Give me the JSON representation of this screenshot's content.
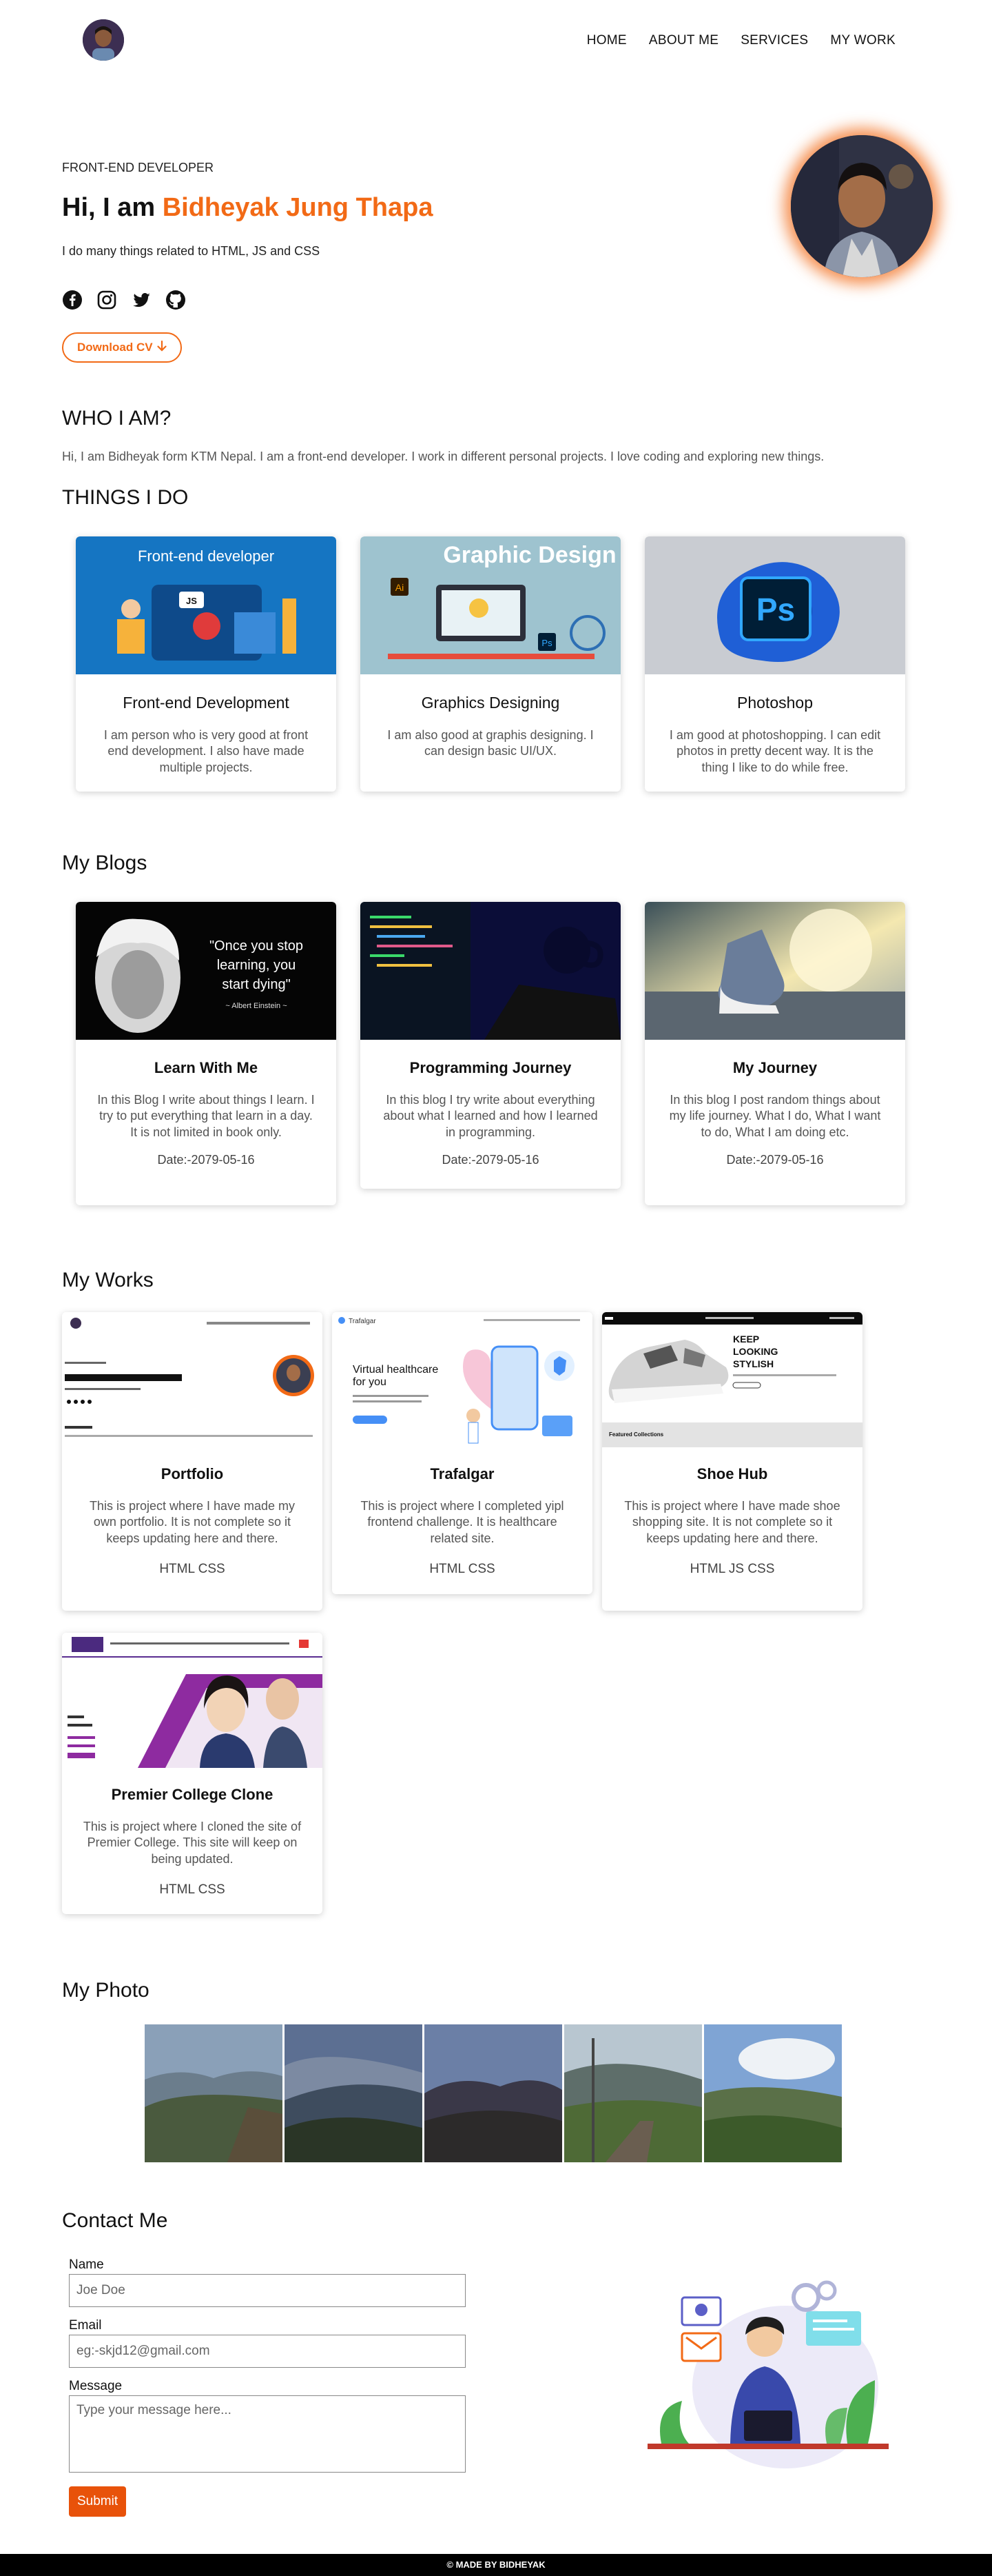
{
  "nav": {
    "links": [
      "HOME",
      "ABOUT ME",
      "SERVICES",
      "MY WORK"
    ]
  },
  "hero": {
    "role": "FRONT-END DEVELOPER",
    "greeting": "Hi, I am ",
    "name": "Bidheyak Jung Thapa",
    "subtitle": "I do many things related to HTML, JS and CSS",
    "social_icons": [
      "facebook-icon",
      "instagram-icon",
      "twitter-icon",
      "github-icon"
    ],
    "cv_button": "Download CV",
    "accent": "#f26a16"
  },
  "who": {
    "heading": "WHO I AM?",
    "text": "Hi, I am Bidheyak form KTM Nepal. I am a front-end developer. I work in different personal projects. I love coding and exploring new things."
  },
  "things": {
    "heading": "THINGS I DO",
    "cards": [
      {
        "title": "Front-end Development",
        "text": "I am person who is very good at front end development. I also have made multiple projects.",
        "image_caption": "Front-end developer"
      },
      {
        "title": "Graphics Designing",
        "text": "I am also good at graphis designing. I can design basic UI/UX.",
        "image_caption": "Graphic Design"
      },
      {
        "title": "Photoshop",
        "text": "I am good at photoshopping. I can edit photos in pretty decent way. It is the thing I like to do while free.",
        "image_caption": "Ps"
      }
    ]
  },
  "blogs": {
    "heading": "My Blogs",
    "cards": [
      {
        "title": "Learn With Me",
        "text": "In this Blog I write about things I learn. I try to put everything that learn in a day. It is not limited in book only.",
        "date": "Date:-2079-05-16",
        "quote": "\"Once you stop learning, you start dying\"",
        "quote_author": "~ Albert Einstein ~"
      },
      {
        "title": "Programming Journey",
        "text": "In this blog I try write about everything about what I learned and how I learned in programming.",
        "date": "Date:-2079-05-16"
      },
      {
        "title": "My Journey",
        "text": "In this blog I post random things about my life journey. What I do, What I want to do, What I am doing etc.",
        "date": "Date:-2079-05-16"
      }
    ]
  },
  "works": {
    "heading": "My Works",
    "cards": [
      {
        "title": "Portfolio",
        "text": "This is project where I have made my own portfolio. It is not complete so it keeps updating here and there.",
        "tech": "HTML CSS"
      },
      {
        "title": "Trafalgar",
        "text": "This is project where I completed yipl frontend challenge. It is healthcare related site.",
        "tech": "HTML CSS",
        "preview_heading": "Virtual healthcare for you",
        "preview_logo": "Trafalgar"
      },
      {
        "title": "Shoe Hub",
        "text": "This is project where I have made shoe shopping site. It is not complete so it keeps updating here and there.",
        "tech": "HTML JS CSS",
        "preview_heading": "KEEP LOOKING STYLISH",
        "preview_footer": "Featured Collections"
      },
      {
        "title": "Premier College Clone",
        "text": "This is project where I cloned the site of Premier College. This site will keep on being updated.",
        "tech": "HTML CSS"
      }
    ]
  },
  "photos": {
    "heading": "My Photo",
    "count": 5
  },
  "contact": {
    "heading": "Contact Me",
    "name_label": "Name",
    "name_placeholder": "Joe Doe",
    "email_label": "Email",
    "email_placeholder": "eg:-skjd12@gmail.com",
    "message_label": "Message",
    "message_placeholder": "Type your message here...",
    "submit": "Submit"
  },
  "footer": {
    "text": "© MADE BY BIDHEYAK"
  }
}
